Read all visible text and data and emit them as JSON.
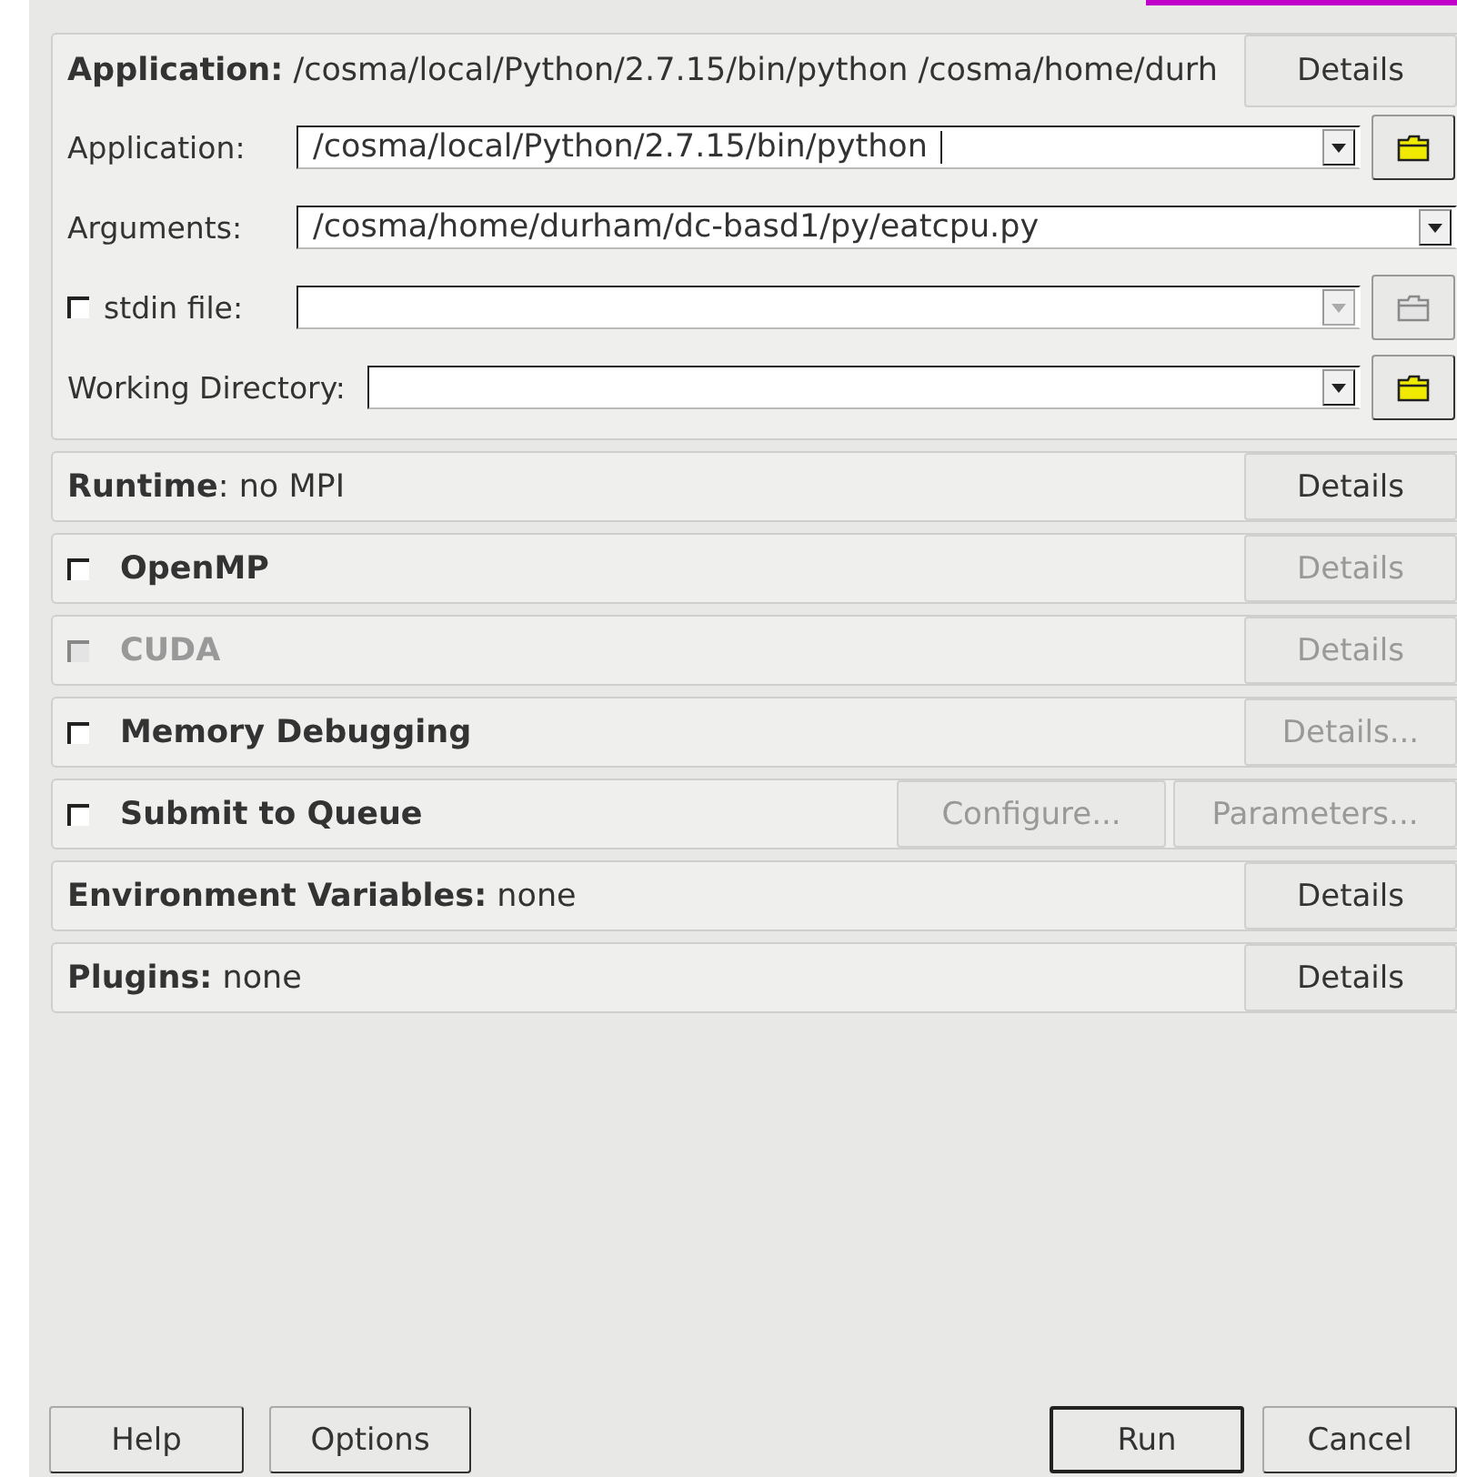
{
  "application_panel": {
    "header": "**Application:** /cosma/local/Python/2.7.15/bin/python /cosma/home/durh",
    "details_button": "Details",
    "fields": [
      {
        "kind": "combo",
        "label": "Application:",
        "value": "/cosma/local/Python/2.7.15/bin/python ",
        "browse": true,
        "disabled": false
      },
      {
        "kind": "combo",
        "label": "Arguments:",
        "value": "/cosma/home/durham/dc-basd1/py/eatcpu.py",
        "browse": false,
        "disabled": false
      },
      {
        "kind": "checkcombo",
        "label": "stdin file:",
        "checked": false,
        "browse": true,
        "disabled": true
      },
      {
        "kind": "combo",
        "label": "Working Directory:",
        "browse": true,
        "disabled": false
      }
    ]
  },
  "sections": [
    {
      "kind": "header",
      "text": "**Runtime**: no MPI",
      "buttons": [
        {
          "label": "Details",
          "disabled": false
        }
      ]
    },
    {
      "kind": "check",
      "text": "OpenMP",
      "checked": false,
      "disabled": false,
      "buttons": [
        {
          "label": "Details",
          "disabled": true
        }
      ]
    },
    {
      "kind": "check",
      "text": "CUDA",
      "checked": false,
      "disabled": true,
      "buttons": [
        {
          "label": "Details",
          "disabled": true
        }
      ]
    },
    {
      "kind": "check",
      "text": "Memory Debugging",
      "checked": false,
      "disabled": false,
      "buttons": [
        {
          "label": "Details...",
          "disabled": true
        }
      ]
    },
    {
      "kind": "check",
      "text": "Submit to Queue",
      "checked": false,
      "disabled": false,
      "buttons": [
        {
          "label": "Configure...",
          "disabled": true
        },
        {
          "label": "Parameters...",
          "disabled": true
        }
      ]
    },
    {
      "kind": "header",
      "text": "**Environment Variables:** none",
      "buttons": [
        {
          "label": "Details",
          "disabled": false
        }
      ]
    },
    {
      "kind": "header",
      "text": "**Plugins:** none",
      "buttons": [
        {
          "label": "Details",
          "disabled": false
        }
      ]
    }
  ],
  "footer": {
    "left_buttons": [
      {
        "label": "Help",
        "default": false
      },
      {
        "label": "Options",
        "default": false
      }
    ],
    "right_buttons": [
      {
        "label": "Run",
        "default": true
      },
      {
        "label": "Cancel",
        "default": false
      }
    ]
  }
}
